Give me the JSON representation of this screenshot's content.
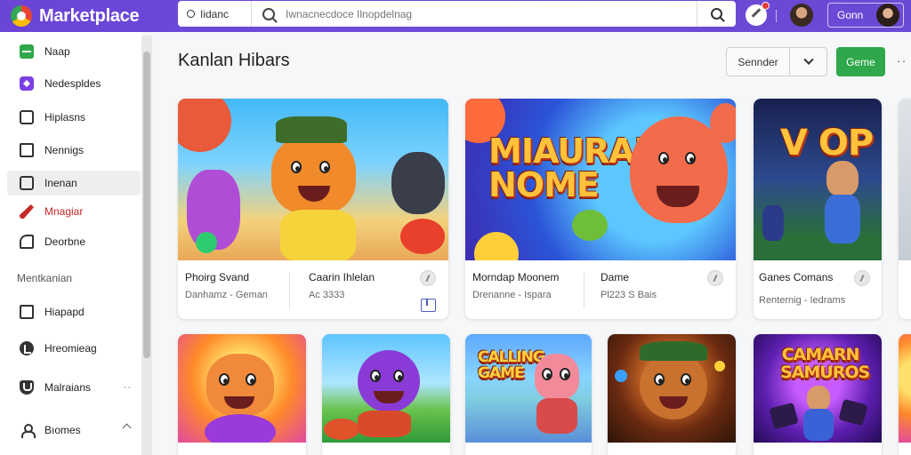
{
  "app": {
    "title": "Marketplace"
  },
  "header": {
    "scope_label": "Iidanc",
    "search_placeholder": "Iwnacnecdoce Ilnopdelnag",
    "account_label": "Gonn"
  },
  "sidebar": {
    "items": [
      {
        "label": "Naap",
        "icon": "store-icon"
      },
      {
        "label": "Nedespldes",
        "icon": "diamond-icon"
      },
      {
        "label": "Hiplasns",
        "icon": "square-icon"
      },
      {
        "label": "Nennigs",
        "icon": "box-icon"
      },
      {
        "label": "Inenan",
        "icon": "tv-icon"
      },
      {
        "label": "Mnagiar",
        "icon": "pencil-icon"
      },
      {
        "label": "Deorbne",
        "icon": "corner-icon"
      }
    ],
    "section_label": "Mentkanian",
    "section_items": [
      {
        "label": "Hiapapd",
        "icon": "box-icon"
      },
      {
        "label": "Hreomieag",
        "icon": "check-circle-icon"
      },
      {
        "label": "Malraians",
        "icon": "shield-icon",
        "more": "··"
      },
      {
        "label": "Bıomes",
        "icon": "person-icon"
      }
    ]
  },
  "main": {
    "title": "Kanlan Hibars",
    "sort_label": "Sennder",
    "action_label": "Geme",
    "more_label": "··"
  },
  "cards": [
    {
      "art_label": "",
      "title_left": "Phoirg Svand",
      "sub_left": "Danhamz - Geman",
      "title_right": "Caarin Ihlelan",
      "sub_right": "Ac 3333"
    },
    {
      "art_label": "MIAURAN NOME",
      "title_left": "Morndap Moonem",
      "sub_left": "Drenanne - Ispara",
      "title_right": "Dame",
      "sub_right": "Pl223 S Bais"
    },
    {
      "art_label": "V OP",
      "title_left": "Ganes Comans",
      "sub_left": "Renternig - Iedrams"
    }
  ],
  "row2_cards": [
    {
      "art_label": ""
    },
    {
      "art_label": ""
    },
    {
      "art_label": "CALLING GAME"
    },
    {
      "art_label": ""
    },
    {
      "art_label": "CAMARN SAMUROS"
    }
  ],
  "colors": {
    "topbar": "#6a45d6",
    "accent_green": "#2ea84a",
    "active_red": "#c62828"
  }
}
